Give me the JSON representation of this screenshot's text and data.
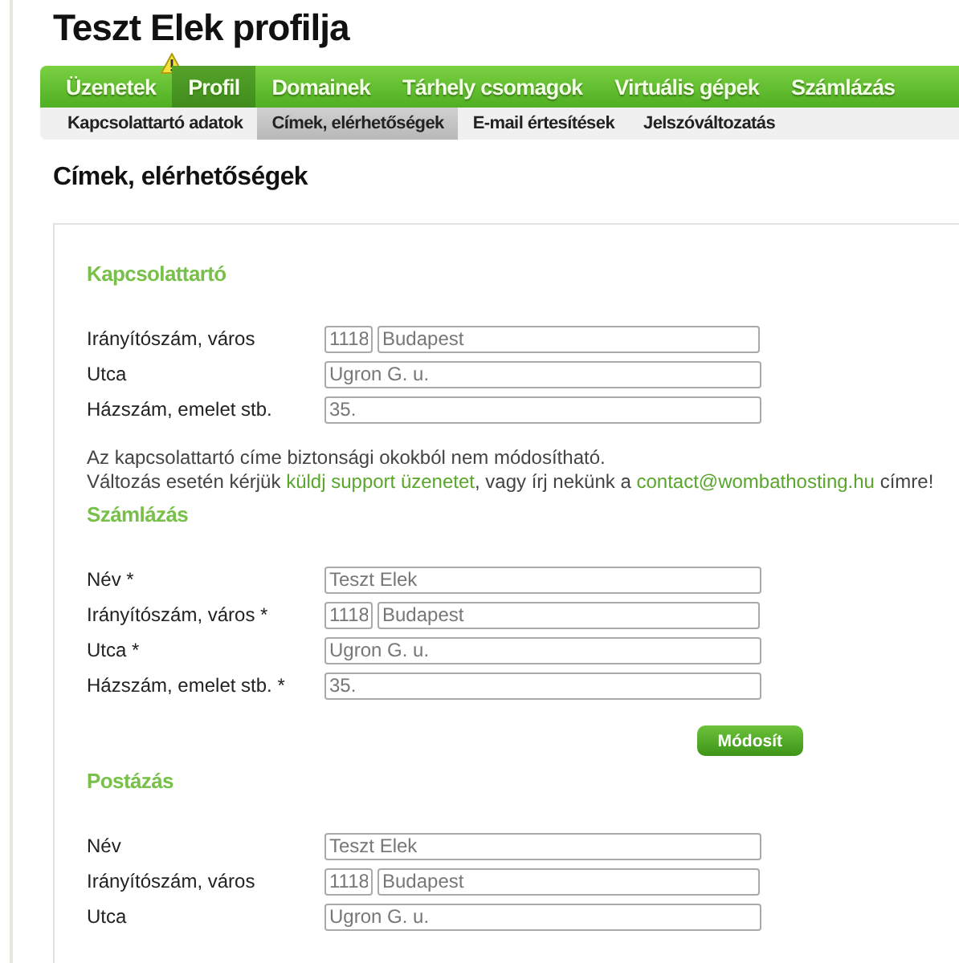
{
  "page_title": "Teszt Elek profilja",
  "main_nav": [
    {
      "label": "Üzenetek",
      "selected": false,
      "warning": true
    },
    {
      "label": "Profil",
      "selected": true,
      "warning": false
    },
    {
      "label": "Domainek",
      "selected": false,
      "warning": false
    },
    {
      "label": "Tárhely csomagok",
      "selected": false,
      "warning": false
    },
    {
      "label": "Virtuális gépek",
      "selected": false,
      "warning": false
    },
    {
      "label": "Számlázás",
      "selected": false,
      "warning": false
    }
  ],
  "sub_nav": [
    {
      "label": "Kapcsolattartó adatok",
      "selected": false
    },
    {
      "label": "Címek, elérhetőségek",
      "selected": true
    },
    {
      "label": "E-mail értesítések",
      "selected": false
    },
    {
      "label": "Jelszóváltozatás",
      "selected": false
    }
  ],
  "heading": "Címek, elérhetőségek",
  "sections": [
    {
      "title": "Kapcsolattartó",
      "fields": [
        {
          "kind": "pair",
          "label": "Irányítószám, város",
          "zip": "1118",
          "value": "Budapest"
        },
        {
          "kind": "text",
          "label": "Utca",
          "value": "Ugron G. u."
        },
        {
          "kind": "text",
          "label": "Házszám, emelet stb.",
          "value": "35."
        }
      ],
      "note": [
        [
          {
            "text": "Az kapcsolattartó címe biztonsági okokból nem módosítható.",
            "link": false
          }
        ],
        [
          {
            "text": "Változás esetén kérjük ",
            "link": false
          },
          {
            "text": "küldj support üzenetet",
            "link": true
          },
          {
            "text": ", vagy írj nekünk a ",
            "link": false
          },
          {
            "text": "contact@wombathosting.hu",
            "link": true
          },
          {
            "text": " címre!",
            "link": false
          }
        ]
      ]
    },
    {
      "title": "Számlázás",
      "fields": [
        {
          "kind": "text",
          "label": "Név *",
          "value": "Teszt Elek"
        },
        {
          "kind": "pair",
          "label": "Irányítószám, város *",
          "zip": "1118",
          "value": "Budapest"
        },
        {
          "kind": "text",
          "label": "Utca *",
          "value": "Ugron G. u."
        },
        {
          "kind": "text",
          "label": "Házszám, emelet stb. *",
          "value": "35."
        }
      ],
      "button": "Módosít"
    },
    {
      "title": "Postázás",
      "fields": [
        {
          "kind": "text",
          "label": "Név",
          "value": "Teszt Elek"
        },
        {
          "kind": "pair",
          "label": "Irányítószám, város",
          "zip": "1118",
          "value": "Budapest"
        },
        {
          "kind": "text",
          "label": "Utca",
          "value": "Ugron G. u."
        }
      ]
    }
  ]
}
